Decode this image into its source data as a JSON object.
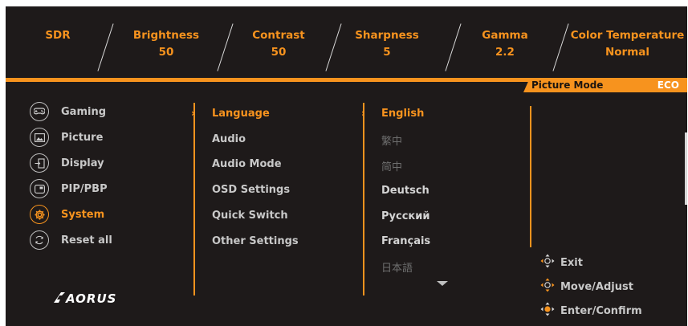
{
  "header": {
    "items": [
      {
        "label": "SDR",
        "value": ""
      },
      {
        "label": "Brightness",
        "value": "50"
      },
      {
        "label": "Contrast",
        "value": "50"
      },
      {
        "label": "Sharpness",
        "value": "5"
      },
      {
        "label": "Gamma",
        "value": "2.2"
      },
      {
        "label": "Color Temperature",
        "value": "Normal"
      }
    ]
  },
  "picture_mode": {
    "label": "Picture Mode",
    "value": "ECO"
  },
  "main_menu": {
    "items": [
      {
        "label": "Gaming",
        "icon": "gamepad-icon"
      },
      {
        "label": "Picture",
        "icon": "picture-icon"
      },
      {
        "label": "Display",
        "icon": "display-input-icon"
      },
      {
        "label": "PIP/PBP",
        "icon": "pip-icon"
      },
      {
        "label": "System",
        "icon": "gear-icon"
      },
      {
        "label": "Reset all",
        "icon": "reset-icon"
      }
    ],
    "selected": "System"
  },
  "sub_menu": {
    "items": [
      "Language",
      "Audio",
      "Audio Mode",
      "OSD Settings",
      "Quick Switch",
      "Other Settings"
    ],
    "selected": "Language"
  },
  "options": {
    "items": [
      "English",
      "繁中",
      "简中",
      "Deutsch",
      "Русский",
      "Français",
      "日本語"
    ],
    "selected": "English"
  },
  "hints": {
    "items": [
      {
        "label": "Exit",
        "icon": "joystick-exit-icon"
      },
      {
        "label": "Move/Adjust",
        "icon": "joystick-move-icon"
      },
      {
        "label": "Enter/Confirm",
        "icon": "joystick-enter-icon"
      }
    ]
  },
  "brand": {
    "logo": "AORUS"
  },
  "colors": {
    "accent": "#f7931e",
    "background": "#1e1a1a",
    "text": "#c8c8c8",
    "dim_text": "#6e6e6e"
  }
}
